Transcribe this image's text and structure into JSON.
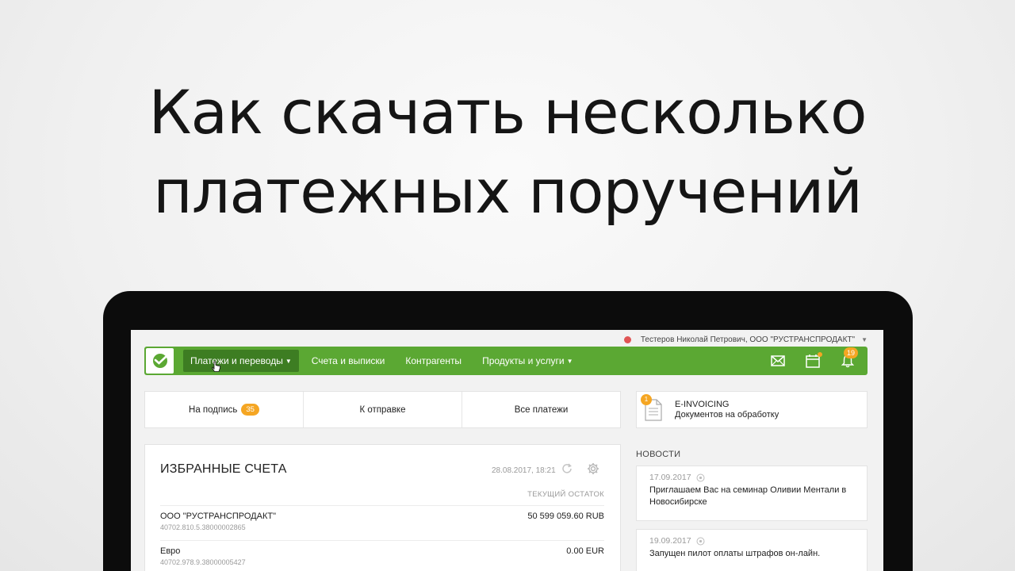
{
  "headline": {
    "line1": "Как скачать несколько",
    "line2": "платежных поручений"
  },
  "user": {
    "name": "Тестеров Николай Петрович, ООО \"РУСТРАНСПРОДАКТ\""
  },
  "nav": {
    "items": [
      {
        "label": "Платежи и переводы"
      },
      {
        "label": "Счета и выписки"
      },
      {
        "label": "Контрагенты"
      },
      {
        "label": "Продукты и услуги"
      }
    ],
    "notification_count": "19"
  },
  "tabs": [
    {
      "label": "На подпись",
      "badge": "35"
    },
    {
      "label": "К отправке"
    },
    {
      "label": "Все платежи"
    }
  ],
  "einvoicing": {
    "badge": "1",
    "title": "E-INVOICING",
    "subtitle": "Документов на обработку"
  },
  "accounts": {
    "title": "ИЗБРАННЫЕ СЧЕТА",
    "updated": "28.08.2017, 18:21",
    "column_header": "ТЕКУЩИЙ ОСТАТОК",
    "rows": [
      {
        "name": "ООО \"РУСТРАНСПРОДАКТ\"",
        "number": "40702.810.5.38000002865",
        "balance": "50 599 059.60 RUB"
      },
      {
        "name": "Евро",
        "number": "40702.978.9.38000005427",
        "balance": "0.00 EUR"
      }
    ]
  },
  "news": {
    "header": "НОВОСТИ",
    "items": [
      {
        "date": "17.09.2017",
        "text": "Приглашаем Вас на семинар Оливии Ментали в Новосибирске"
      },
      {
        "date": "19.09.2017",
        "text": "Запущен пилот оплаты штрафов он-лайн."
      }
    ]
  },
  "colors": {
    "brand_green": "#5ba833",
    "active_nav": "#3d7d22",
    "badge_orange": "#f5a623",
    "status_red": "#e05555"
  },
  "icons": [
    "logo-icon",
    "mouse-cursor-icon",
    "mail-icon",
    "calendar-icon",
    "bell-icon",
    "document-icon",
    "refresh-icon",
    "gear-icon",
    "eye-icon"
  ]
}
